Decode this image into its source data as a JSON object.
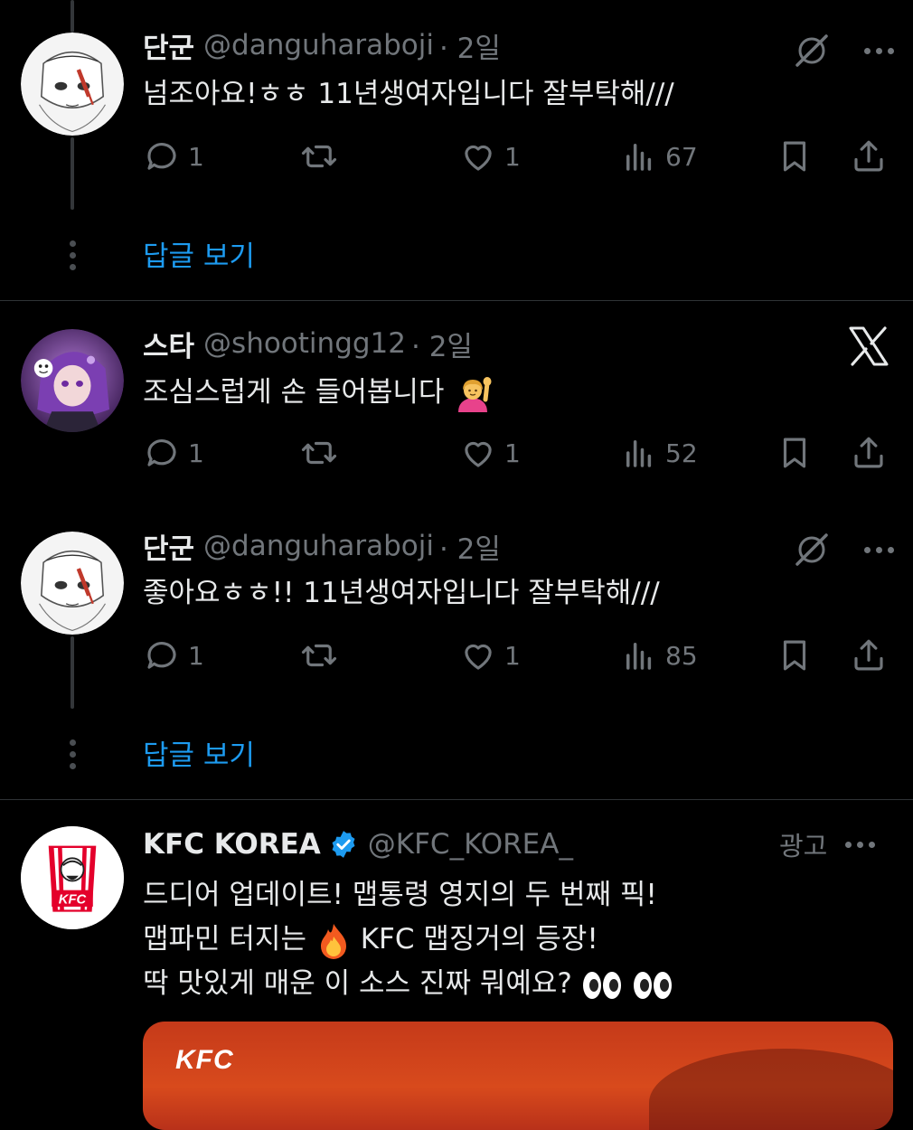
{
  "tweets": [
    {
      "name": "단군",
      "handle": "@danguharaboji",
      "time": "· 2일",
      "text": "넘조아요!ㅎㅎ 11년생여자입니다 잘부탁해///",
      "reply_count": "1",
      "retweet_count": "",
      "like_count": "1",
      "view_count": "67",
      "show_replies": "답글 보기"
    },
    {
      "name": "스타",
      "handle": "@shootingg12",
      "time": "· 2일",
      "text": "조심스럽게 손 들어봅니다",
      "reply_count": "1",
      "retweet_count": "",
      "like_count": "1",
      "view_count": "52"
    },
    {
      "name": "단군",
      "handle": "@danguharaboji",
      "time": "· 2일",
      "text": "좋아요ㅎㅎ!! 11년생여자입니다 잘부탁해///",
      "reply_count": "1",
      "retweet_count": "",
      "like_count": "1",
      "view_count": "85",
      "show_replies": "답글 보기"
    }
  ],
  "ad": {
    "name": "KFC KOREA",
    "handle": "@KFC_KOREA_",
    "label": "광고",
    "line1": "드디어 업데이트! 맵통령 영지의 두 번째 픽!",
    "line2_a": "맵파민 터지는 ",
    "line2_b": "KFC 맵징거의 등장!",
    "line3": "딱 맛있게 매운 이 소스 진짜 뭐예요? ",
    "logo_text": "KFC",
    "media_brand": "KFC"
  },
  "colors": {
    "background": "#000000",
    "text": "#e7e9ea",
    "muted": "#71767b",
    "link": "#1d9bf0",
    "verified": "#1d9bf0",
    "kfc_red": "#e4002b"
  },
  "icons": [
    "reply-icon",
    "retweet-icon",
    "like-icon",
    "views-icon",
    "bookmark-icon",
    "share-icon",
    "grok-icon",
    "more-icon",
    "x-logo-icon",
    "verified-icon",
    "fire-emoji",
    "raising-hand-emoji",
    "eyes-emoji"
  ]
}
